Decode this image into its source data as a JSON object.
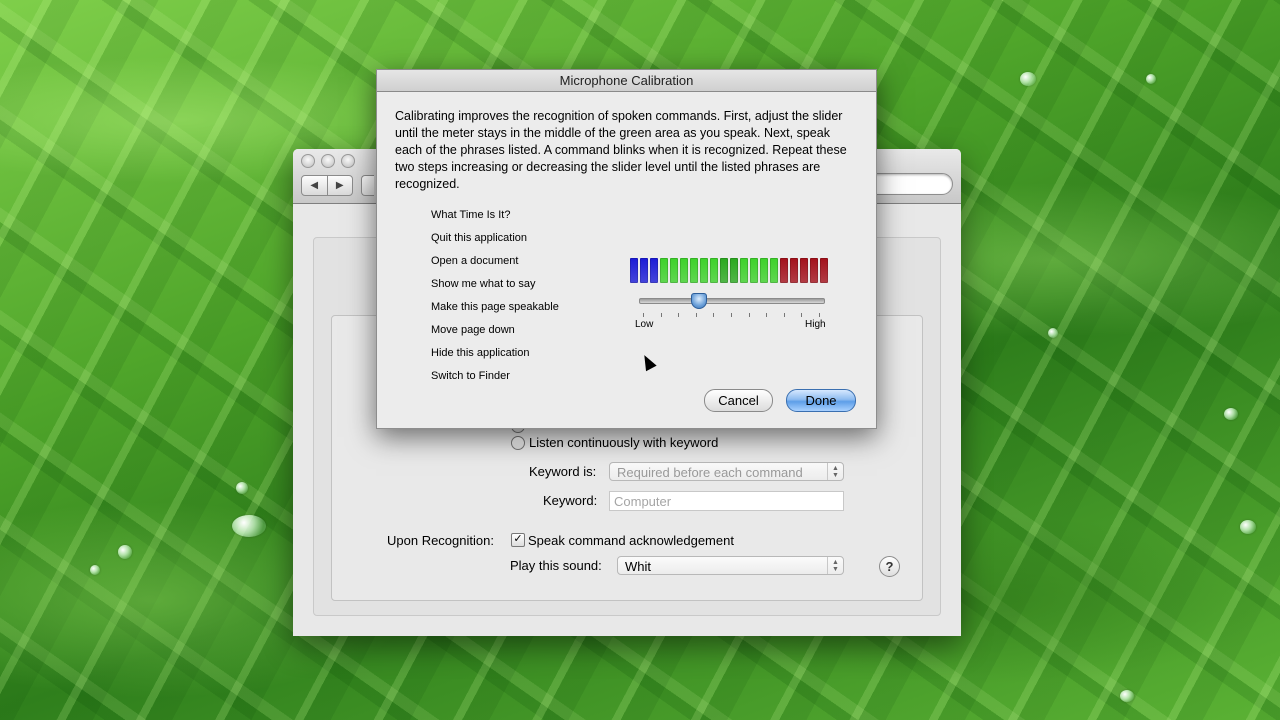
{
  "desktop": {
    "wallpaper": "grass-with-dew"
  },
  "sheet": {
    "title": "Microphone Calibration",
    "instructions": "Calibrating improves the recognition of spoken commands. First, adjust the slider until the meter stays in the middle of the green area as you speak. Next, speak each of the phrases listed. A command blinks when it is recognized. Repeat these two steps increasing or decreasing the slider level until the listed phrases are recognized.",
    "phrases": [
      "What Time Is It?",
      "Quit this application",
      "Open a document",
      "Show me what to say",
      "Make this page speakable",
      "Move page down",
      "Hide this application",
      "Switch to Finder"
    ],
    "meter": {
      "segments": [
        "blue",
        "blue",
        "blue",
        "green",
        "green",
        "green",
        "green",
        "green",
        "green",
        "green",
        "green",
        "green",
        "green",
        "green",
        "green",
        "red",
        "red",
        "red",
        "red",
        "red"
      ],
      "colors": {
        "blue": "#1a1ad6",
        "green": "#3dd12a",
        "red": "#a3101a"
      }
    },
    "slider": {
      "low_label": "Low",
      "high_label": "High",
      "value": 0.32
    },
    "cancel_label": "Cancel",
    "done_label": "Done"
  },
  "prefs": {
    "listen_continuously_label": "Listen continuously with keyword",
    "keyword_is_label": "Keyword is:",
    "keyword_is_value": "Required before each command",
    "keyword_label": "Keyword:",
    "keyword_value": "Computer",
    "upon_recognition_label": "Upon Recognition:",
    "speak_ack_label": "Speak command acknowledgement",
    "speak_ack_checked": true,
    "play_sound_label": "Play this sound:",
    "play_sound_value": "Whit",
    "help_symbol": "?"
  }
}
